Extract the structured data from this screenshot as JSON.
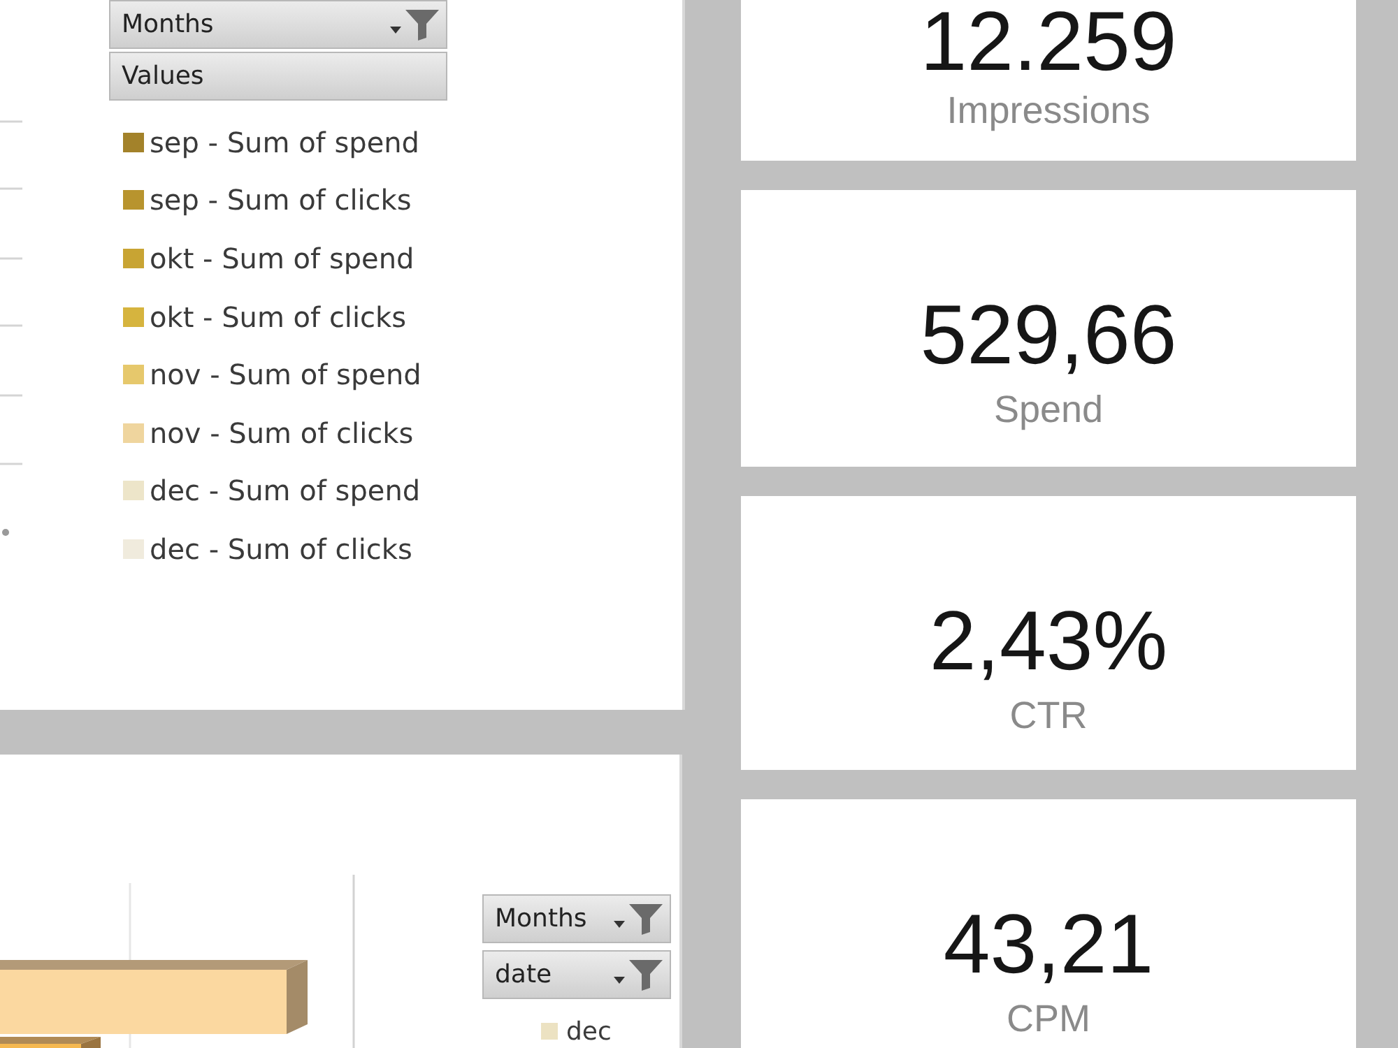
{
  "top_chart": {
    "field_buttons": [
      {
        "label": "Months",
        "filtered": true
      },
      {
        "label": "Values",
        "filtered": false
      }
    ],
    "legend": [
      {
        "label": "sep - Sum of spend",
        "color": "#a3822a"
      },
      {
        "label": "sep - Sum of clicks",
        "color": "#b8942e"
      },
      {
        "label": "okt - Sum of spend",
        "color": "#c8a433"
      },
      {
        "label": "okt - Sum of clicks",
        "color": "#d6b43e"
      },
      {
        "label": "nov - Sum of spend",
        "color": "#e6c86c"
      },
      {
        "label": "nov - Sum of clicks",
        "color": "#efd59e"
      },
      {
        "label": "dec - Sum of spend",
        "color": "#ede5c9"
      },
      {
        "label": "dec - Sum of clicks",
        "color": "#f0ebdd"
      }
    ]
  },
  "bottom_chart": {
    "field_buttons": [
      {
        "label": "Months",
        "filtered": true
      },
      {
        "label": "date",
        "filtered": true
      }
    ],
    "legend": [
      {
        "label": "dec",
        "color": "#ece2c2"
      }
    ]
  },
  "kpi_cards": [
    {
      "value": "12.259",
      "label": "Impressions"
    },
    {
      "value": "529,66",
      "label": "Spend"
    },
    {
      "value": "2,43%",
      "label": "CTR"
    },
    {
      "value": "43,21",
      "label": "CPM"
    }
  ]
}
